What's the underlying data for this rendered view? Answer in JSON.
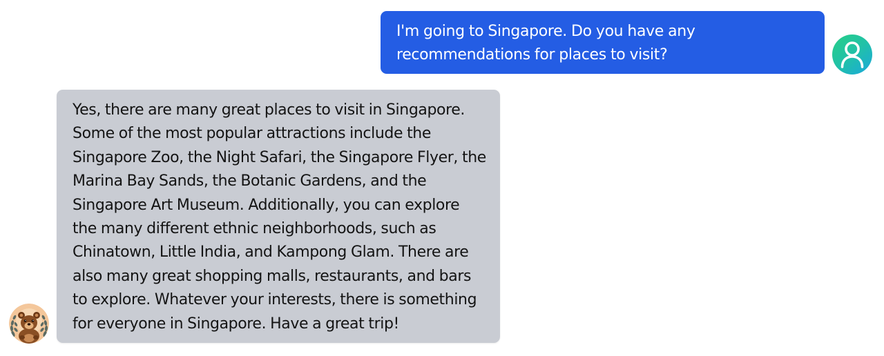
{
  "conversation": {
    "messages": [
      {
        "role": "user",
        "text": "I'm going to Singapore. Do you have any recommendations for places to visit?",
        "avatar_icon": "user-icon"
      },
      {
        "role": "assistant",
        "text": "Yes, there are many great places to visit in Singapore. Some of the most popular attractions include the Singapore Zoo, the Night Safari, the Singapore Flyer, the Marina Bay Sands, the Botanic Gardens, and the Singapore Art Museum. Additionally, you can explore the many different ethnic neighborhoods, such as Chinatown, Little India, and Kampong Glam. There are also many great shopping malls, restaurants, and bars to explore. Whatever your interests, there is something for everyone in Singapore. Have a great trip!",
        "avatar_icon": "bear-mascot-icon"
      }
    ]
  },
  "colors": {
    "user_bubble": "#245de4",
    "bot_bubble": "#c9ccd3",
    "user_avatar_gradient_start": "#27cf86",
    "user_avatar_gradient_end": "#1aa8dd"
  }
}
